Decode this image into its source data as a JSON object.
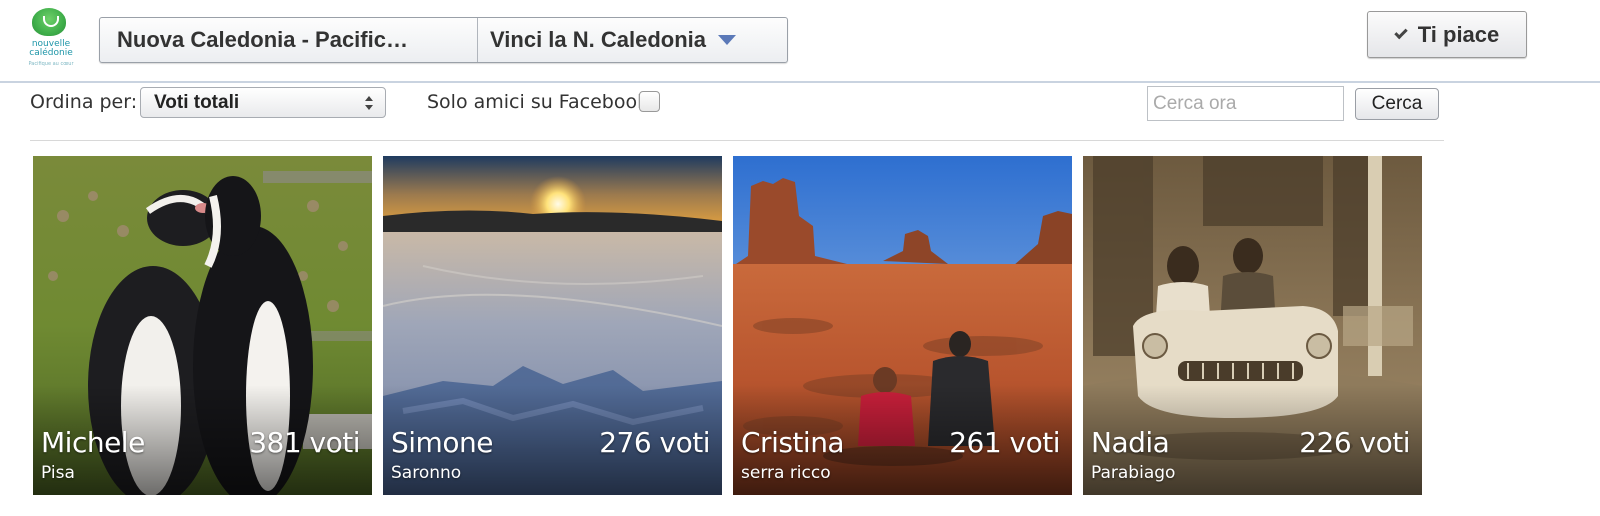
{
  "logo": {
    "text": "nouvelle calédonie",
    "tagline": "Pacifique au cœur"
  },
  "header": {
    "page_selector": "Nuova Caledonia - Pacific…",
    "app_selector": "Vinci la N. Caledonia",
    "like_label": "Ti piace"
  },
  "filters": {
    "sort_label": "Ordina per:",
    "sort_value": "Voti totali",
    "friends_label": "Solo amici su Facebook",
    "friends_checked": false,
    "search_placeholder": "Cerca ora",
    "search_value": "",
    "search_button": "Cerca"
  },
  "entries": [
    {
      "name": "Michele",
      "votes": "381 voti",
      "city": "Pisa",
      "photo": "penguins"
    },
    {
      "name": "Simone",
      "votes": "276 voti",
      "city": "Saronno",
      "photo": "snow-sunset"
    },
    {
      "name": "Cristina",
      "votes": "261 voti",
      "city": "serra ricco",
      "photo": "desert-buttes"
    },
    {
      "name": "Nadia",
      "votes": "226 voti",
      "city": "Parabiago",
      "photo": "vintage-car"
    }
  ],
  "colors": {
    "accent": "#5b79b8",
    "divider": "#c9d3e0",
    "logo_green": "#3fae4a",
    "logo_teal": "#1e96a8"
  }
}
